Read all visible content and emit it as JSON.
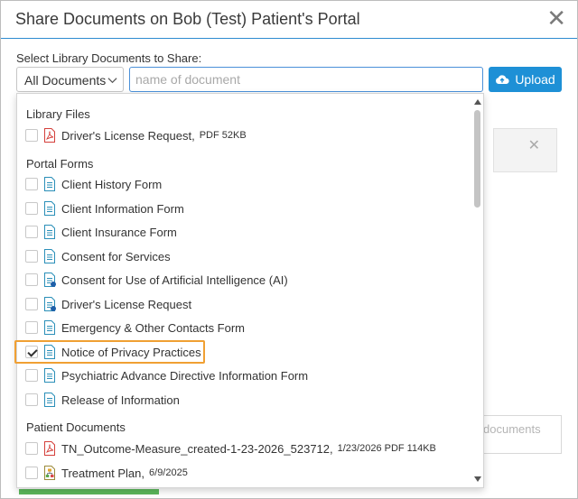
{
  "dialog": {
    "title": "Share Documents on Bob (Test) Patient's Portal",
    "close": "✕"
  },
  "select_label": "Select Library Documents to Share:",
  "filter": {
    "value": "All Documents"
  },
  "search": {
    "placeholder": "name of document"
  },
  "upload": {
    "label": "Upload"
  },
  "background": {
    "drop_text": "documents"
  },
  "groups": {
    "library": {
      "label": "Library Files",
      "items": [
        {
          "name": "Driver's License Request,",
          "meta": "PDF 52KB",
          "icon": "pdf-icon",
          "checked": false
        }
      ]
    },
    "portal": {
      "label": "Portal Forms",
      "items": [
        {
          "name": "Client History Form",
          "icon": "form-icon",
          "checked": false
        },
        {
          "name": "Client Information Form",
          "icon": "form-icon",
          "checked": false
        },
        {
          "name": "Client Insurance Form",
          "icon": "form-icon",
          "checked": false
        },
        {
          "name": "Consent for Services",
          "icon": "form-icon",
          "checked": false
        },
        {
          "name": "Consent for Use of Artificial Intelligence (AI)",
          "icon": "form-sign-icon",
          "checked": false
        },
        {
          "name": "Driver's License Request",
          "icon": "form-sign-icon",
          "checked": false
        },
        {
          "name": "Emergency & Other Contacts Form",
          "icon": "form-icon",
          "checked": false
        },
        {
          "name": "Notice of Privacy Practices",
          "icon": "form-icon",
          "checked": true
        },
        {
          "name": "Psychiatric Advance Directive Information Form",
          "icon": "form-icon",
          "checked": false
        },
        {
          "name": "Release of Information",
          "icon": "form-icon",
          "checked": false
        }
      ]
    },
    "patient": {
      "label": "Patient Documents",
      "items": [
        {
          "name": "TN_Outcome-Measure_created-1-23-2026_523712,",
          "meta": "1/23/2026 PDF 114KB",
          "icon": "pdf-icon",
          "checked": false
        },
        {
          "name": "Treatment Plan,",
          "meta": "6/9/2025",
          "icon": "treatment-plan-icon",
          "checked": false
        }
      ]
    }
  },
  "colors": {
    "accent": "#1e90d6",
    "highlight": "#f0a033",
    "pdf_red": "#d43f3a",
    "form_teal": "#2a8fb8"
  }
}
